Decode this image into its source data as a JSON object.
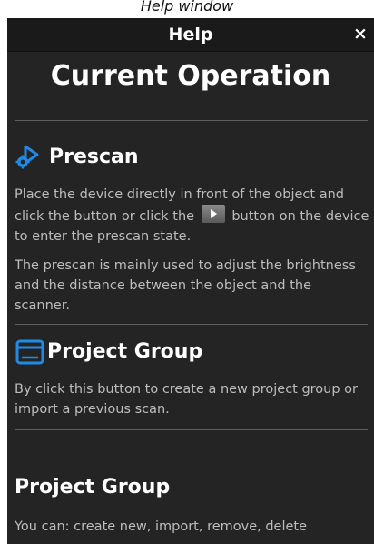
{
  "caption": "Help window",
  "window": {
    "title": "Help",
    "close_label": "×"
  },
  "main_heading": "Current Operation",
  "sections": [
    {
      "title": "Prescan",
      "icon": "prescan-icon",
      "para1_before": "Place the device directly in front of the object and click the button or click the",
      "para1_after": "button on the device to enter the prescan state.",
      "para2": "The prescan is mainly used to adjust the brightness and the distance between the object and the scanner."
    },
    {
      "title": "Project Group",
      "icon": "project-group-icon",
      "para1": "By click this button to create a new project group or import a previous scan."
    },
    {
      "title": "Project Group",
      "para1": "You can: create new, import, remove, delete"
    }
  ],
  "colors": {
    "window_bg": "#242424",
    "titlebar_bg": "#1a1a1a",
    "accent": "#1f8be6",
    "body_text": "#bdbdbd"
  }
}
